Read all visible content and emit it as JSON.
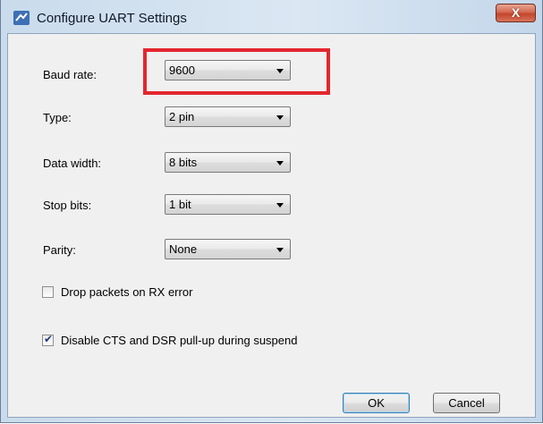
{
  "window": {
    "title": "Configure UART Settings",
    "close_label": "X"
  },
  "fields": [
    {
      "label": "Baud rate:",
      "value": "9600"
    },
    {
      "label": "Type:",
      "value": "2 pin"
    },
    {
      "label": "Data width:",
      "value": "8 bits"
    },
    {
      "label": "Stop bits:",
      "value": "1 bit"
    },
    {
      "label": "Parity:",
      "value": "None"
    }
  ],
  "checkboxes": [
    {
      "label": "Drop packets on RX error",
      "checked": false
    },
    {
      "label": "Disable CTS and DSR pull-up during suspend",
      "checked": true
    }
  ],
  "buttons": {
    "ok": "OK",
    "cancel": "Cancel"
  },
  "colors": {
    "highlight": "#e3262f",
    "title_bar": "#d4e3f2",
    "dialog_bg": "#f0f0f0"
  }
}
